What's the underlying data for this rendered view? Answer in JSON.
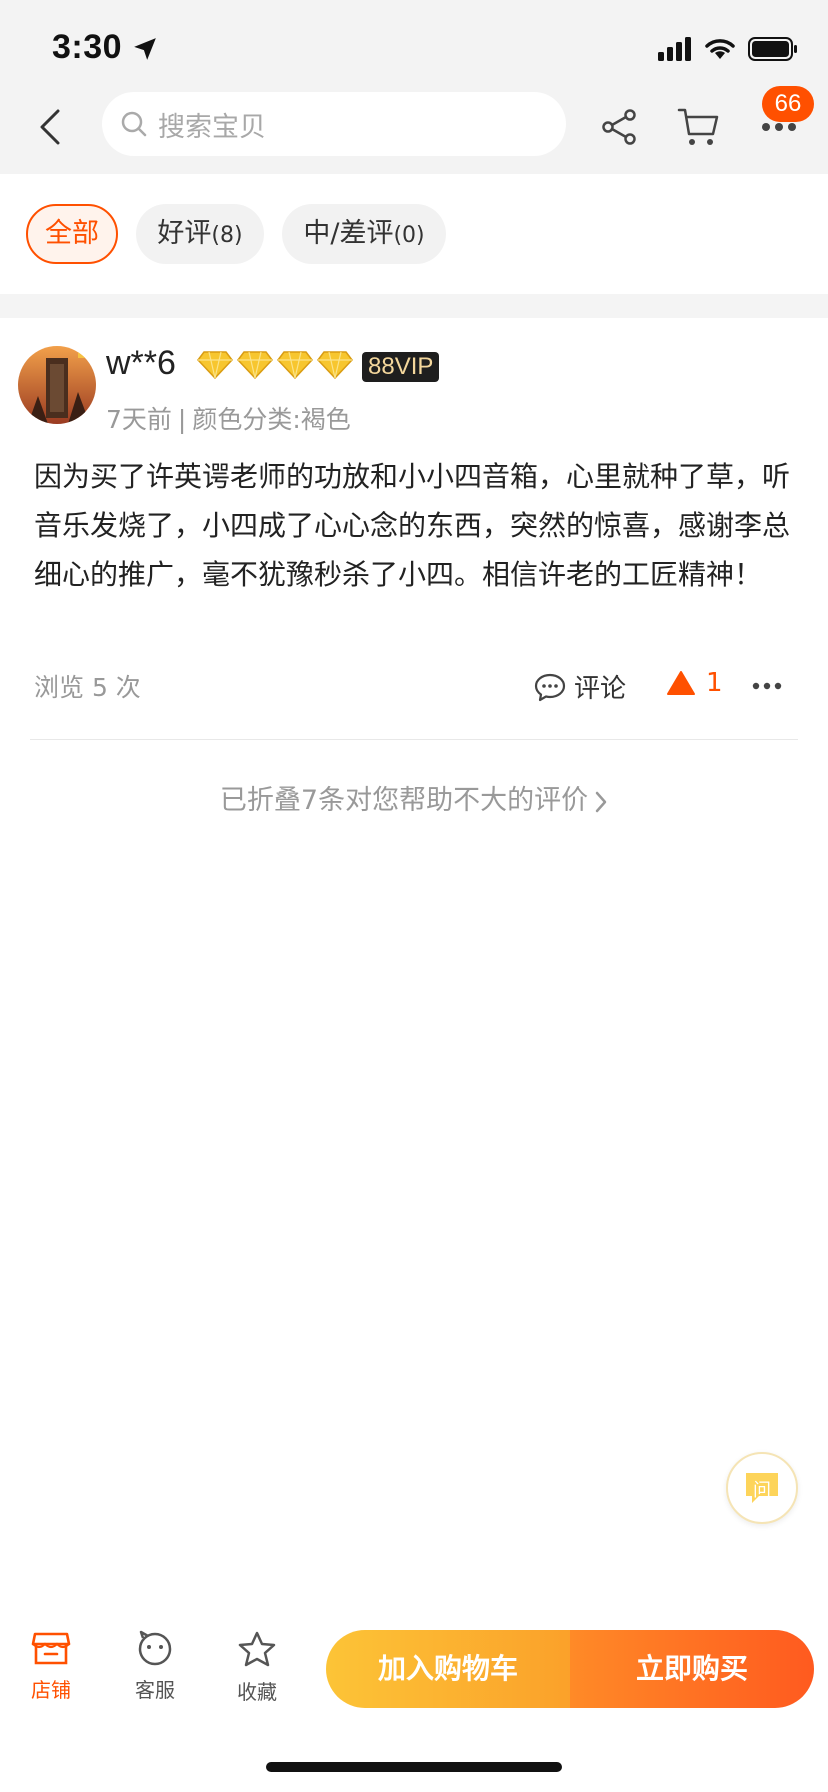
{
  "status_bar": {
    "time": "3:30"
  },
  "header": {
    "search_placeholder": "搜索宝贝",
    "badge_count": "66"
  },
  "filters": [
    {
      "label": "全部",
      "count": ""
    },
    {
      "label": "好评",
      "count": "(8)"
    },
    {
      "label": "中/差评",
      "count": "(0)"
    }
  ],
  "review": {
    "username": "w**6",
    "vip_badge": "88VIP",
    "diamond_count": 4,
    "time": "7天前",
    "variant": "颜色分类:褐色",
    "content": "因为买了许英谔老师的功放和小小四音箱，心里就种了草，听音乐发烧了，小四成了心心念的东西，突然的惊喜，感谢李总细心的推广，毫不犹豫秒杀了小四。相信许老的工匠精神！",
    "views": "浏览 5 次",
    "comment_label": "评论",
    "like_count": "1"
  },
  "folded_text": "已折叠7条对您帮助不大的评价",
  "ask_label": "问",
  "bottom_bar": {
    "store_label": "店铺",
    "service_label": "客服",
    "favorite_label": "收藏",
    "add_cart_label": "加入购物车",
    "buy_now_label": "立即购买"
  },
  "colors": {
    "accent": "#ff5000",
    "cart_button": "#fbb531",
    "buy_button": "#ff6a24"
  }
}
